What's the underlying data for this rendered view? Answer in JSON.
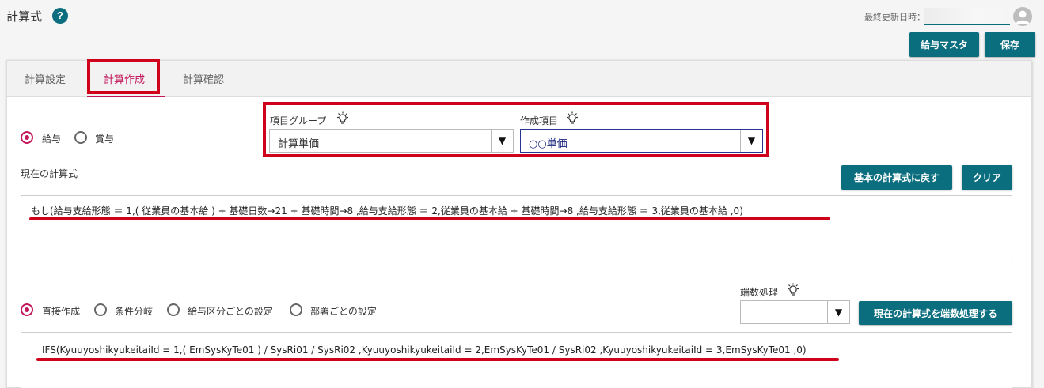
{
  "header": {
    "title": "計算式",
    "help_icon": "?",
    "updated_label": "最終更新日時：",
    "master_button": "給与マスタ",
    "save_button": "保存"
  },
  "tabs": [
    {
      "label": "計算設定"
    },
    {
      "label": "計算作成"
    },
    {
      "label": "計算確認"
    }
  ],
  "pay_type": {
    "options": [
      "給与",
      "賞与"
    ],
    "selected": "給与"
  },
  "item_group": {
    "label": "項目グループ",
    "value": "計算単価"
  },
  "create_item": {
    "label": "作成項目",
    "value": "○○単価"
  },
  "current_formula": {
    "label": "現在の計算式",
    "reset_button": "基本の計算式に戻す",
    "clear_button": "クリア",
    "text": "もし(給与支給形態 ＝ 1,( 従業員の基本給 ) ÷ 基礎日数→21 ÷ 基礎時間→8 ,給与支給形態 ＝ 2,従業員の基本給 ÷ 基礎時間→8  ,給与支給形態 ＝ 3,従業員の基本給  ,0)"
  },
  "creation_mode": {
    "options": [
      "直接作成",
      "条件分岐",
      "給与区分ごとの設定",
      "部署ごとの設定"
    ],
    "selected": "直接作成"
  },
  "rounding": {
    "label": "端数処理",
    "value": "",
    "apply_button": "現在の計算式を端数処理する"
  },
  "raw_formula": {
    "text": "IFS(KyuuyoshikyukeitaiId = 1,( EmSysKyTe01 ) / SysRi01 / SysRi02 ,KyuuyoshikyukeitaiId = 2,EmSysKyTe01 / SysRi02  ,KyuuyoshikyukeitaiId = 3,EmSysKyTe01  ,0)"
  },
  "colors": {
    "accent": "#0b6e7f",
    "active_tab": "#c2185b",
    "highlight": "#d0021b"
  },
  "icons": [
    "help-icon",
    "user-avatar-icon",
    "lightbulb-icon",
    "dropdown-arrow-icon"
  ]
}
